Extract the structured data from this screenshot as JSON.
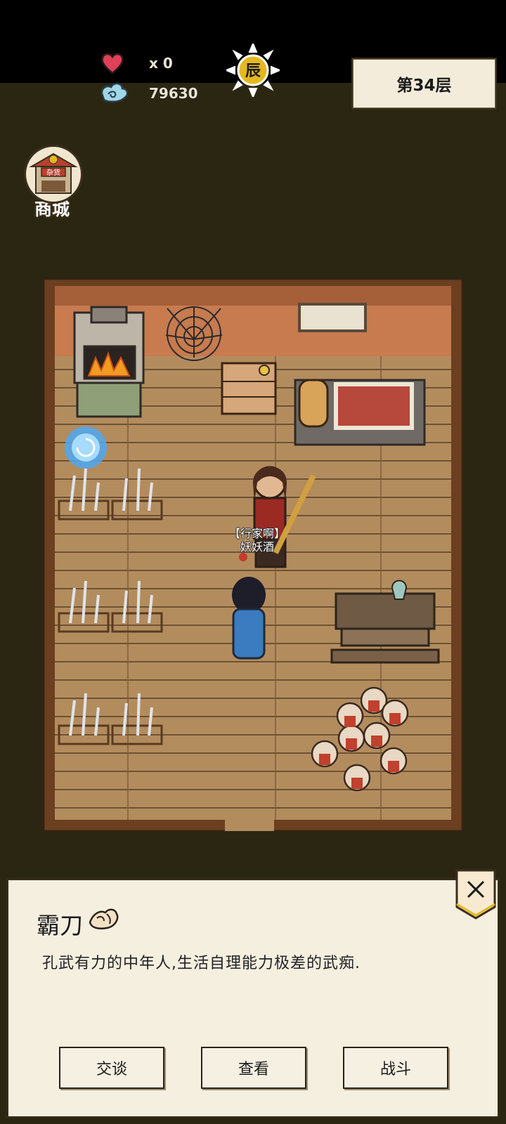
{
  "hud": {
    "lives": "x 0",
    "spirit": "79630",
    "time_glyph": "辰",
    "floor": "第34层"
  },
  "shop": {
    "label": "商城",
    "sign_text": "杂货"
  },
  "npc": {
    "tag_line1": "【行家啊】",
    "tag_line2": "妖妖酒"
  },
  "dialog": {
    "name": "霸刀",
    "description": "孔武有力的中年人,生活自理能力极差的武痴.",
    "buttons": {
      "talk": "交谈",
      "inspect": "查看",
      "fight": "战斗"
    }
  },
  "colors": {
    "accent": "#e4b820",
    "heart": "#e0405a",
    "panel_bg": "#f5efe0"
  }
}
